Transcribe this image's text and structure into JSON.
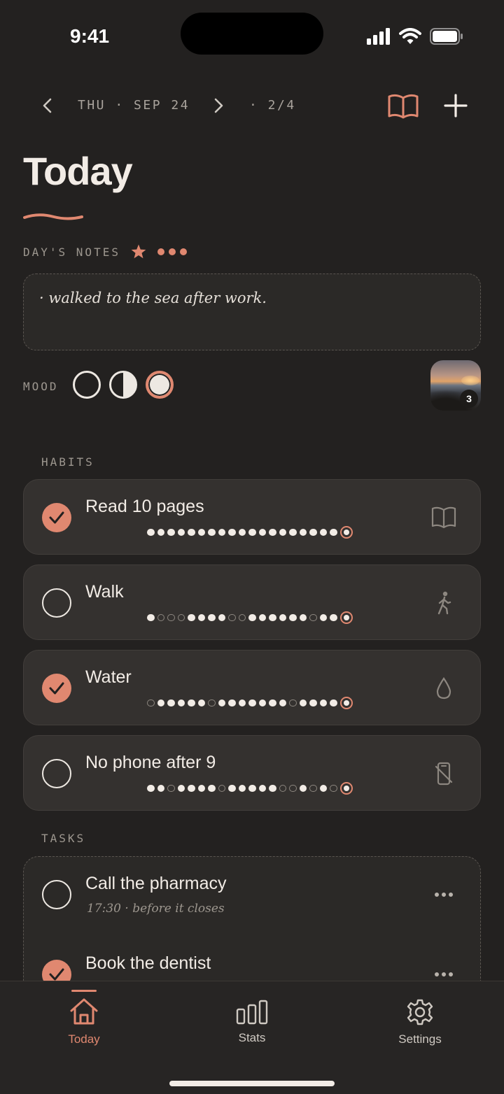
{
  "status_bar": {
    "time": "9:41"
  },
  "top_nav": {
    "date": "THU · SEP 24",
    "page_counter": "· 2/4"
  },
  "page_title": "Today",
  "notes": {
    "label": "DAY'S NOTES",
    "text": "· walked to the sea after work."
  },
  "mood": {
    "label": "MOOD",
    "options": [
      "empty",
      "half",
      "full"
    ],
    "selected": "full"
  },
  "photo": {
    "count": "3"
  },
  "habits": {
    "label": "HABITS",
    "items": [
      {
        "name": "Read 10 pages",
        "done": true,
        "icon": "book-icon",
        "streak": [
          1,
          1,
          1,
          1,
          1,
          1,
          1,
          1,
          1,
          1,
          1,
          1,
          1,
          1,
          1,
          1,
          1,
          1,
          1,
          1
        ]
      },
      {
        "name": "Walk",
        "done": false,
        "icon": "walking-person-icon",
        "streak": [
          1,
          0,
          0,
          0,
          1,
          1,
          1,
          1,
          0,
          0,
          1,
          1,
          1,
          1,
          1,
          1,
          0,
          1,
          1,
          1
        ]
      },
      {
        "name": "Water",
        "done": true,
        "icon": "water-drop-icon",
        "streak": [
          0,
          1,
          1,
          1,
          1,
          1,
          0,
          1,
          1,
          1,
          1,
          1,
          1,
          1,
          0,
          1,
          1,
          1,
          1,
          1
        ]
      },
      {
        "name": "No phone after 9",
        "done": false,
        "icon": "no-phone-icon",
        "streak": [
          1,
          1,
          0,
          1,
          1,
          1,
          1,
          0,
          1,
          1,
          1,
          1,
          1,
          0,
          0,
          1,
          0,
          1,
          0,
          1
        ]
      }
    ]
  },
  "tasks": {
    "label": "TASKS",
    "items": [
      {
        "title": "Call the pharmacy",
        "subtitle": "17:30 · before it closes",
        "done": false
      },
      {
        "title": "Book the dentist",
        "subtitle": "",
        "done": true
      }
    ]
  },
  "tab_bar": {
    "items": [
      {
        "label": "Today",
        "icon": "home-icon",
        "active": true
      },
      {
        "label": "Stats",
        "icon": "bar-chart-icon",
        "active": false
      },
      {
        "label": "Settings",
        "icon": "gear-icon",
        "active": false
      }
    ]
  },
  "colors": {
    "accent": "#e08870",
    "background": "#232120",
    "card": "#34312f",
    "text": "#f2ece6"
  }
}
